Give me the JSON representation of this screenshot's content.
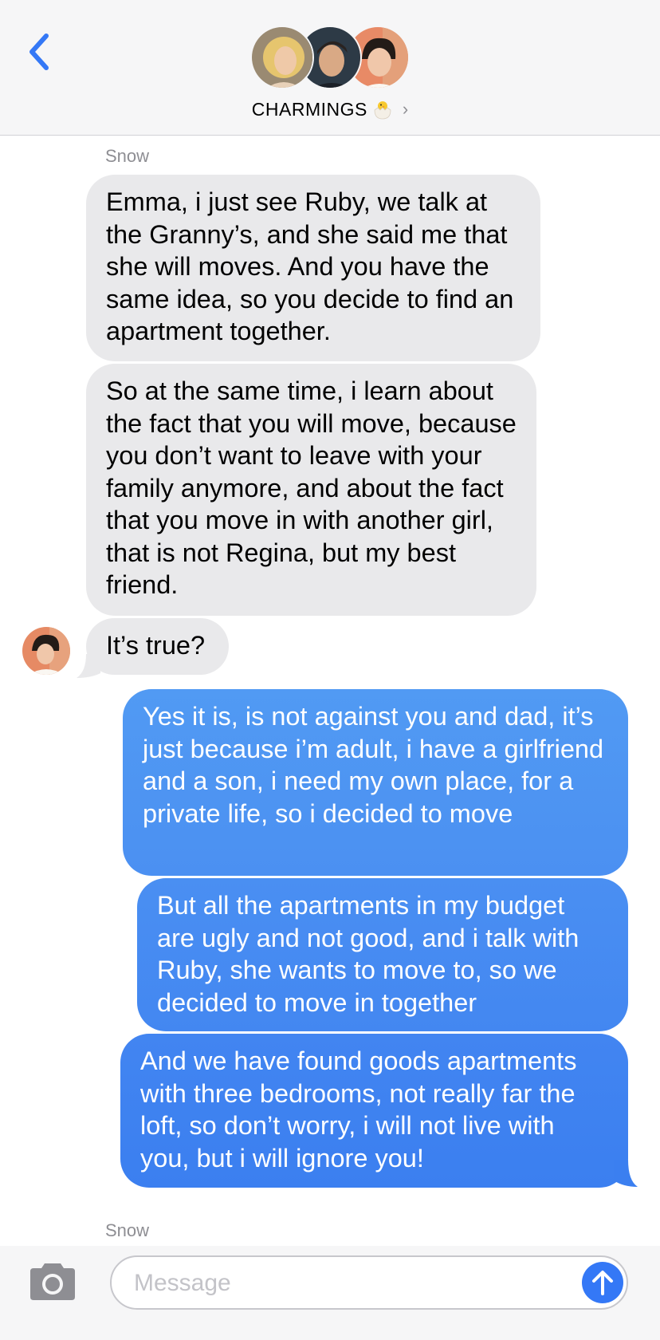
{
  "header": {
    "title": "CHARMINGS",
    "chevron": "›",
    "back_icon": "chevron-left-icon",
    "title_emoji": "hatching-chick-icon"
  },
  "messages": [
    {
      "sender": "Snow"
    },
    {
      "direction": "incoming",
      "text": "Emma, i just see Ruby, we talk at the Granny’s, and she said me that she will moves. And you have the same idea, so you decide to find an apartment together."
    },
    {
      "direction": "incoming",
      "text": "So at the same time, i learn about the fact that you will move, because you don’t want to leave with your family anymore, and about the fact that you move in with another girl, that is not Regina, but my best friend."
    },
    {
      "direction": "incoming",
      "text": "It’s true?"
    },
    {
      "direction": "outgoing",
      "text": "Yes it is, is not against you and dad, it’s just because i’m adult, i have a girlfriend and a son, i need my own place, for a private life, so i decided to move"
    },
    {
      "direction": "outgoing",
      "text": "But all the apartments in my budget are ugly and not good, and i talk with Ruby, she wants to move to, so we decided to move in together"
    },
    {
      "direction": "outgoing",
      "text": "And we have found goods apartments with three bedrooms, not really far the loft, so don’t worry, i will not live with you, but i will ignore you!"
    },
    {
      "sender": "Snow"
    }
  ],
  "input": {
    "placeholder": "Message",
    "value": ""
  },
  "icons": {
    "camera": "camera-icon",
    "send": "arrow-up-icon"
  },
  "colors": {
    "accent": "#3478f6",
    "incoming_bubble": "#e9e9eb",
    "outgoing_top": "#4f95f2",
    "outgoing_bottom": "#3a7ff0",
    "secondary_text": "#8e8e93"
  }
}
